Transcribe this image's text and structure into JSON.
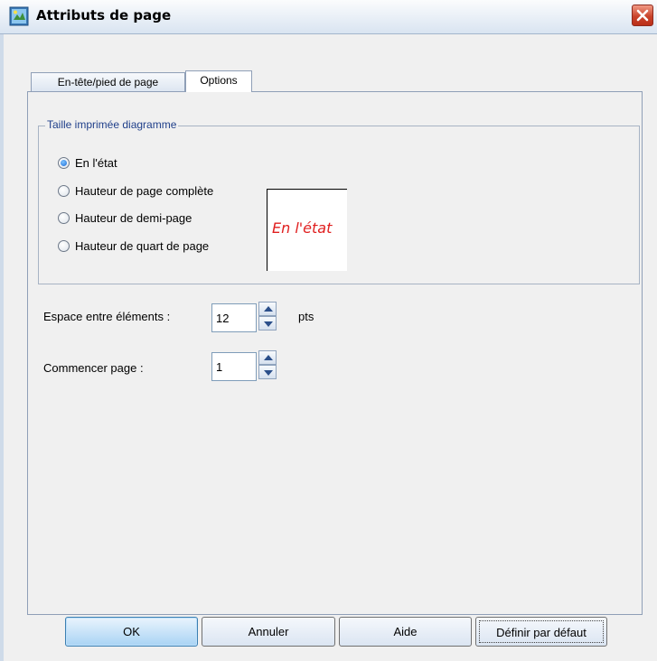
{
  "window": {
    "title": "Attributs de page",
    "app_icon": "page-attributes-icon",
    "close_icon": "close-icon"
  },
  "tabs": [
    {
      "label": "En-tête/pied de page",
      "selected": false
    },
    {
      "label": "Options",
      "selected": true
    }
  ],
  "chart_size": {
    "group_title": "Taille imprimée diagramme",
    "options": [
      {
        "label": "En l'état",
        "checked": true
      },
      {
        "label": "Hauteur de page complète",
        "checked": false
      },
      {
        "label": "Hauteur de demi-page",
        "checked": false
      },
      {
        "label": "Hauteur de quart de page",
        "checked": false
      }
    ],
    "preview_text": "En l'état"
  },
  "spacing": {
    "label": "Espace entre éléments :",
    "value": "12",
    "unit": "pts"
  },
  "start_page": {
    "label": "Commencer page :",
    "value": "1"
  },
  "buttons": {
    "ok": "OK",
    "cancel": "Annuler",
    "help": "Aide",
    "default": "Définir par défaut"
  },
  "colors": {
    "preview_text": "#e02020",
    "group_title": "#1f3f8a"
  }
}
